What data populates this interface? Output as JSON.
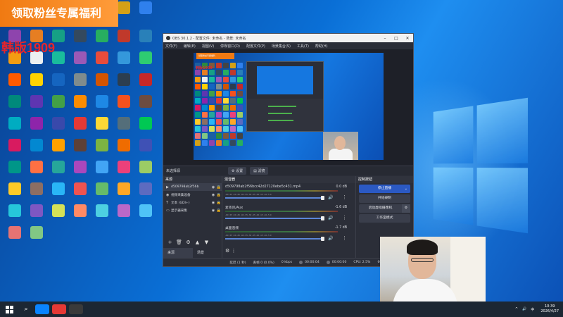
{
  "banner": {
    "text": "领取粉丝专属福利"
  },
  "watermark": {
    "text": "韩版1909"
  },
  "colors": {
    "brand_orange": "#f07a12",
    "watermark_red": "#e8242a",
    "stream_blue": "#2b59c3",
    "obs_bg": "#2b2e38"
  },
  "desktop_icons": [
    {
      "label": "",
      "color": "#1c5fa0"
    },
    {
      "label": "",
      "color": "#2d8a3e"
    },
    {
      "label": "",
      "color": "#7d5a3c"
    },
    {
      "label": "",
      "color": "#c0392b"
    },
    {
      "label": "",
      "color": "#444"
    },
    {
      "label": "",
      "color": "#d4a017"
    },
    {
      "label": "",
      "color": "#2f80ed"
    },
    {
      "label": "",
      "color": "#8e44ad"
    },
    {
      "label": "",
      "color": "#e67e22"
    },
    {
      "label": "",
      "color": "#16a085"
    },
    {
      "label": "",
      "color": "#34495e"
    },
    {
      "label": "",
      "color": "#27ae60"
    },
    {
      "label": "",
      "color": "#c0392b"
    },
    {
      "label": "",
      "color": "#2980b9"
    },
    {
      "label": "",
      "color": "#f39c12"
    },
    {
      "label": "",
      "color": "#ecf0f1"
    },
    {
      "label": "",
      "color": "#1abc9c"
    },
    {
      "label": "",
      "color": "#9b59b6"
    },
    {
      "label": "",
      "color": "#e74c3c"
    },
    {
      "label": "",
      "color": "#3498db"
    },
    {
      "label": "",
      "color": "#2ecc71"
    },
    {
      "label": "",
      "color": "#ff5a00"
    },
    {
      "label": "",
      "color": "#ffd200"
    },
    {
      "label": "",
      "color": "#1565c0"
    },
    {
      "label": "",
      "color": "#7f8c8d"
    },
    {
      "label": "",
      "color": "#d35400"
    },
    {
      "label": "",
      "color": "#2c3e50"
    },
    {
      "label": "",
      "color": "#c62828"
    },
    {
      "label": "",
      "color": "#00897b"
    },
    {
      "label": "",
      "color": "#5e35b1"
    },
    {
      "label": "",
      "color": "#43a047"
    },
    {
      "label": "",
      "color": "#fb8c00"
    },
    {
      "label": "",
      "color": "#1e88e5"
    },
    {
      "label": "",
      "color": "#f4511e"
    },
    {
      "label": "",
      "color": "#6d4c41"
    },
    {
      "label": "",
      "color": "#00acc1"
    },
    {
      "label": "",
      "color": "#8e24aa"
    },
    {
      "label": "",
      "color": "#3949ab"
    },
    {
      "label": "",
      "color": "#e53935"
    },
    {
      "label": "",
      "color": "#fdd835"
    },
    {
      "label": "",
      "color": "#546e7a"
    },
    {
      "label": "",
      "color": "#00c853"
    },
    {
      "label": "",
      "color": "#d81b60"
    },
    {
      "label": "",
      "color": "#0288d1"
    },
    {
      "label": "",
      "color": "#ffa000"
    },
    {
      "label": "",
      "color": "#5d4037"
    },
    {
      "label": "",
      "color": "#7cb342"
    },
    {
      "label": "",
      "color": "#ef6c00"
    },
    {
      "label": "",
      "color": "#3f51b5"
    },
    {
      "label": "",
      "color": "#009688"
    },
    {
      "label": "",
      "color": "#ff7043"
    },
    {
      "label": "",
      "color": "#26a69a"
    },
    {
      "label": "",
      "color": "#ab47bc"
    },
    {
      "label": "",
      "color": "#42a5f5"
    },
    {
      "label": "",
      "color": "#ec407a"
    },
    {
      "label": "",
      "color": "#9ccc65"
    },
    {
      "label": "",
      "color": "#ffca28"
    },
    {
      "label": "",
      "color": "#8d6e63"
    },
    {
      "label": "",
      "color": "#29b6f6"
    },
    {
      "label": "",
      "color": "#ef5350"
    },
    {
      "label": "",
      "color": "#66bb6a"
    },
    {
      "label": "",
      "color": "#ffa726"
    },
    {
      "label": "",
      "color": "#5c6bc0"
    },
    {
      "label": "",
      "color": "#26c6da"
    },
    {
      "label": "",
      "color": "#7e57c2"
    },
    {
      "label": "",
      "color": "#d4e157"
    },
    {
      "label": "",
      "color": "#ff8a65"
    },
    {
      "label": "",
      "color": "#4dd0e1"
    },
    {
      "label": "",
      "color": "#ba68c8"
    },
    {
      "label": "",
      "color": "#4fc3f7"
    },
    {
      "label": "",
      "color": "#e57373"
    },
    {
      "label": "",
      "color": "#81c784"
    }
  ],
  "obs": {
    "title": "OBS 30.1.2 - 配置文件: 未命名 - 场景: 未命名",
    "menu": [
      "文件(F)",
      "编辑(E)",
      "视图(V)",
      "停靠窗口(D)",
      "配置文件(P)",
      "场景集合(S)",
      "工具(T)",
      "帮助(H)"
    ],
    "preview": {
      "banner_text": "领取粉丝专属福利",
      "watermark_text": "韩版1909"
    },
    "context": {
      "scene_label": "未选择源",
      "properties": "设置",
      "filters": "滤镜"
    },
    "sources": {
      "header": "来源",
      "items": [
        {
          "icon": "▶",
          "name": "d509798ab2f56b"
        },
        {
          "icon": "◉",
          "name": "视频采集设备"
        },
        {
          "icon": "T",
          "name": "文本 (GDI+)"
        },
        {
          "icon": "▭",
          "name": "显示器采集"
        }
      ],
      "tools": [
        "+",
        "🗑",
        "⚙",
        "▲",
        "▼"
      ],
      "tabs": [
        "来源",
        "场景"
      ]
    },
    "mixer": {
      "header": "混音器",
      "channels": [
        {
          "name": "d509798ab2f56bcc42d27120ebe5c431.mp4",
          "db": "0.0 dB"
        },
        {
          "name": "麦克风/Aux",
          "db": "-1.6 dB"
        },
        {
          "name": "桌面音频",
          "db": "-1.7 dB"
        }
      ],
      "ticks": "-60 -55 -50 -45 -40 -35 -30 -25 -20 -15 -10 -5 0"
    },
    "controls": {
      "header": "控制按钮",
      "stream": "停止直播",
      "record": "开始录制",
      "vcam": "启动虚拟摄像机",
      "studio": "工作室模式"
    },
    "status": {
      "dropped": "延迟 (1 秒)",
      "frames": "丢帧 0 (0.0%)",
      "kbps": "0 kbps",
      "stream_time": "00:00:04",
      "rec_time": "00:00:00",
      "cpu": "CPU: 2.5%",
      "fps": "60.00 / 60.00 FPS"
    }
  },
  "taskbar": {
    "time": "10:39",
    "date": "2026/4/27",
    "tray": [
      "^",
      "🔊",
      "中"
    ]
  }
}
